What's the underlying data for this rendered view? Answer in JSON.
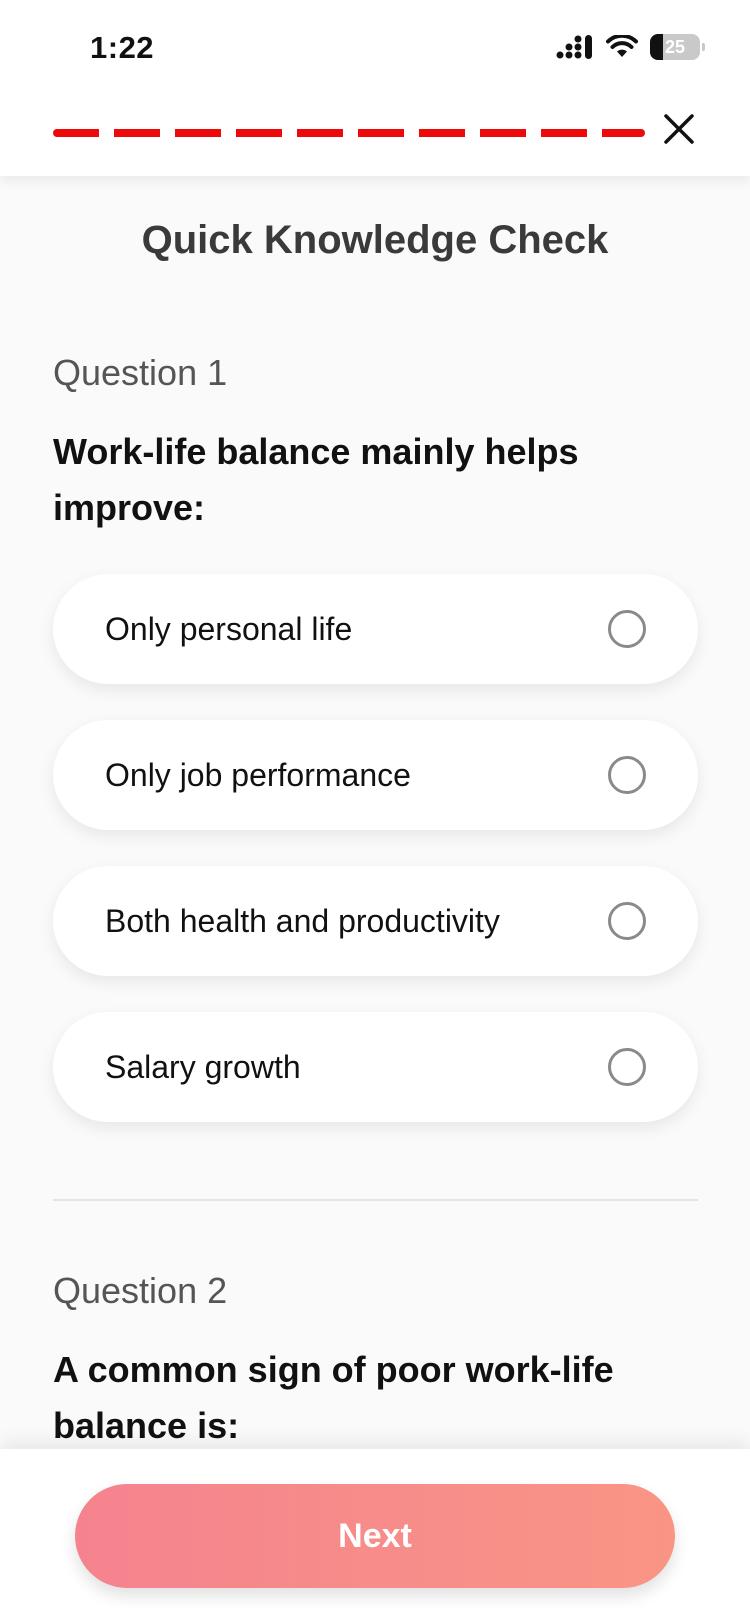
{
  "status_bar": {
    "time": "1:22",
    "battery_level": "25"
  },
  "header": {
    "close_icon": "close-icon",
    "progress_color": "#ee0a0a"
  },
  "title": "Quick Knowledge Check",
  "questions": [
    {
      "label": "Question 1",
      "text": "Work-life balance mainly helps improve:",
      "options": [
        "Only personal life",
        "Only job performance",
        "Both health and productivity",
        "Salary growth"
      ]
    },
    {
      "label": "Question 2",
      "text": "A common sign of poor work-life balance is:"
    }
  ],
  "footer": {
    "next_label": "Next",
    "accent_start": "#f5838f",
    "accent_end": "#f99585"
  }
}
